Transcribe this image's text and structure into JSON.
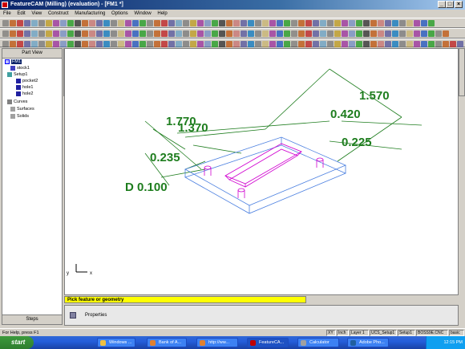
{
  "window": {
    "title": "FeatureCAM (Milling) (evaluation) - [FM1 *]",
    "min": "_",
    "max": "□",
    "close": "×"
  },
  "menu": [
    "File",
    "Edit",
    "View",
    "Construct",
    "Manufacturing",
    "Options",
    "Window",
    "Help"
  ],
  "part_view": {
    "title": "Part View",
    "items": [
      {
        "label": "FM1",
        "icon": "document-icon"
      },
      {
        "label": "stock1",
        "icon": "stock-icon"
      },
      {
        "label": "Setup1",
        "icon": "setup-icon"
      },
      {
        "label": "pocket2",
        "icon": "pocket-icon"
      },
      {
        "label": "hole1",
        "icon": "hole-icon"
      },
      {
        "label": "hole2",
        "icon": "hole-icon"
      },
      {
        "label": "Curves",
        "icon": "curves-icon"
      },
      {
        "label": "Surfaces",
        "icon": "surfaces-icon"
      },
      {
        "label": "Solids",
        "icon": "solids-icon"
      }
    ],
    "steps_tab": "Steps"
  },
  "dimensions": {
    "d1": "1.570",
    "d2": "1.770",
    "d3": "1.370",
    "d4": "0.420",
    "d5": "0.225",
    "d6": "0.235",
    "d7": "D 0.100"
  },
  "axis": {
    "x": "x",
    "y": "y"
  },
  "prompt": "Pick feature or geometry",
  "properties_label": "Properties",
  "status": {
    "help": "For Help, press F1",
    "cells": [
      "XY",
      "Inch",
      "Layer 1",
      "UCS_Setup1",
      "Setup1",
      "BOSS9E.CNC",
      "basic"
    ]
  },
  "taskbar": {
    "start": "start",
    "tasks": [
      "Windows ...",
      "Bank of A...",
      "http://ww...",
      "FeatureCA...",
      "Calculator",
      "Adobe Pho..."
    ],
    "time": "12:15 PM"
  },
  "colors": {
    "dimension": "#1e7d1e",
    "stock": "#4a7fe0",
    "pocket": "#d000d0",
    "prompt_bg": "#ffff00"
  }
}
